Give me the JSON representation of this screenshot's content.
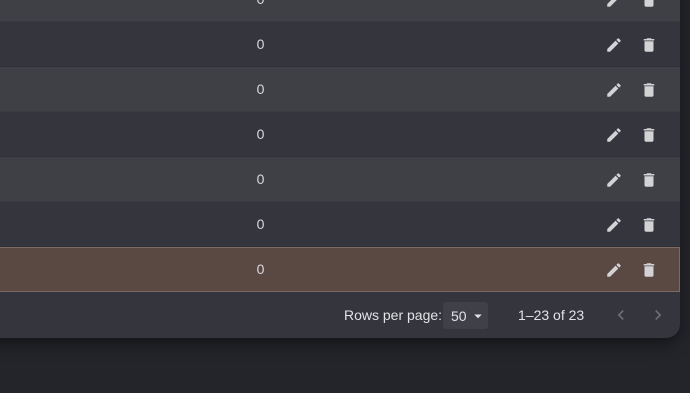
{
  "table": {
    "rows": [
      {
        "value": "0"
      },
      {
        "value": "0"
      },
      {
        "value": "0"
      },
      {
        "value": "0"
      },
      {
        "value": "0"
      },
      {
        "value": "0"
      },
      {
        "value": "0"
      }
    ],
    "selected_row_color": "#5a4843"
  },
  "pagination": {
    "rows_per_page_label": "Rows per page:",
    "rows_per_page_value": "50",
    "range_text": "1–23 of 23",
    "prev_icon": "chevron-left-icon",
    "next_icon": "chevron-right-icon"
  },
  "icons": {
    "edit": "pencil-icon",
    "delete": "trash-icon"
  }
}
